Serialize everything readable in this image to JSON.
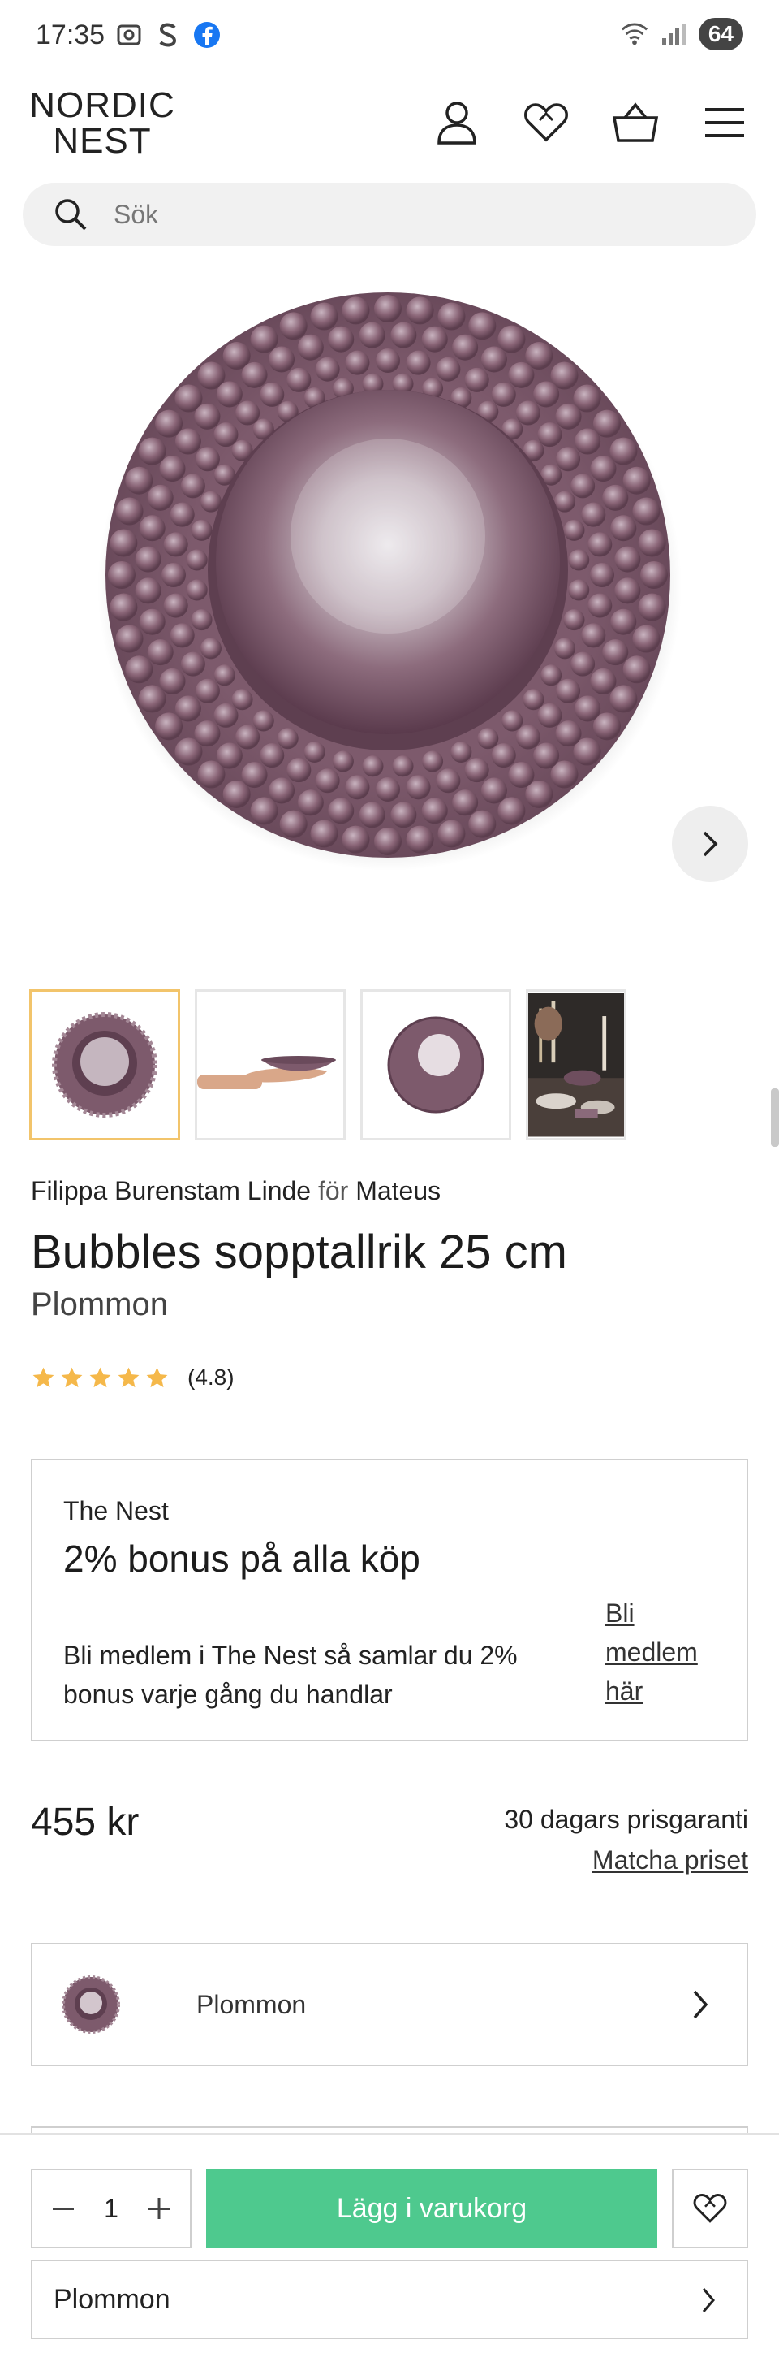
{
  "status_bar": {
    "time": "17:35",
    "left_icons": [
      "screenshot-icon",
      "s-app-icon",
      "facebook-icon"
    ],
    "right_icons": [
      "wifi-icon",
      "signal-icon"
    ],
    "battery": "64"
  },
  "header": {
    "logo_line1": "NORDIC",
    "logo_line2": "NEST",
    "icons": [
      "user-icon",
      "heart-icon",
      "basket-icon",
      "menu-icon"
    ]
  },
  "search": {
    "placeholder": "Sök"
  },
  "product": {
    "designer": "Filippa Burenstam Linde",
    "for_word": "för",
    "brand": "Mateus",
    "title": "Bubbles sopptallrik 25 cm",
    "variant": "Plommon",
    "rating_stars": 5,
    "rating": "(4.8)",
    "thumbnails": [
      "bowl-top",
      "bowl-hand",
      "bowl-plate",
      "table-photo"
    ],
    "active_thumbnail": 0
  },
  "nest_box": {
    "brand": "The Nest",
    "title": "2% bonus på alla köp",
    "description": "Bli medlem i The Nest så samlar du 2% bonus varje gång du handlar",
    "link": "Bli medlem här"
  },
  "pricing": {
    "price": "455 kr",
    "guarantee": "30 dagars prisgaranti",
    "match_link": "Matcha priset"
  },
  "variant_selector": {
    "label": "Plommon"
  },
  "sticky_bar": {
    "quantity": "1",
    "add_to_cart": "Lägg i varukorg",
    "variant_label": "Plommon"
  },
  "colors": {
    "accent_green": "#4ec98e",
    "star_gold": "#f5b84a",
    "plum": "#7a5668",
    "active_thumb_border": "#f2c46b"
  }
}
